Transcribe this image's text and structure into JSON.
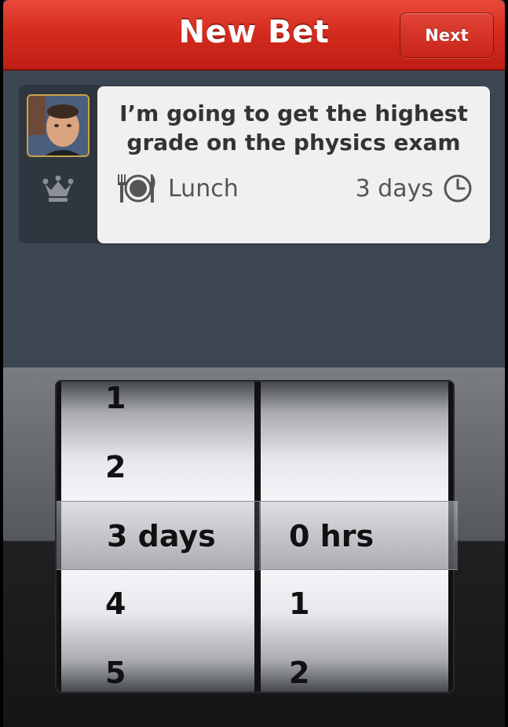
{
  "navbar": {
    "title": "New Bet",
    "next_label": "Next"
  },
  "bet": {
    "statement": "I’m going to get the highest grade on the physics exam",
    "stake": "Lunch",
    "duration": "3 days"
  },
  "picker": {
    "days": {
      "above": [
        "1",
        "2"
      ],
      "selected": "3 days",
      "below": [
        "4",
        "5"
      ]
    },
    "hours": {
      "above": [
        "",
        ""
      ],
      "selected": "0 hrs",
      "below": [
        "1",
        "2"
      ]
    }
  },
  "colors": {
    "accent": "#d52c1f",
    "background": "#3c4552"
  },
  "icons": [
    "crown-icon",
    "plate-cutlery-icon",
    "clock-icon"
  ]
}
